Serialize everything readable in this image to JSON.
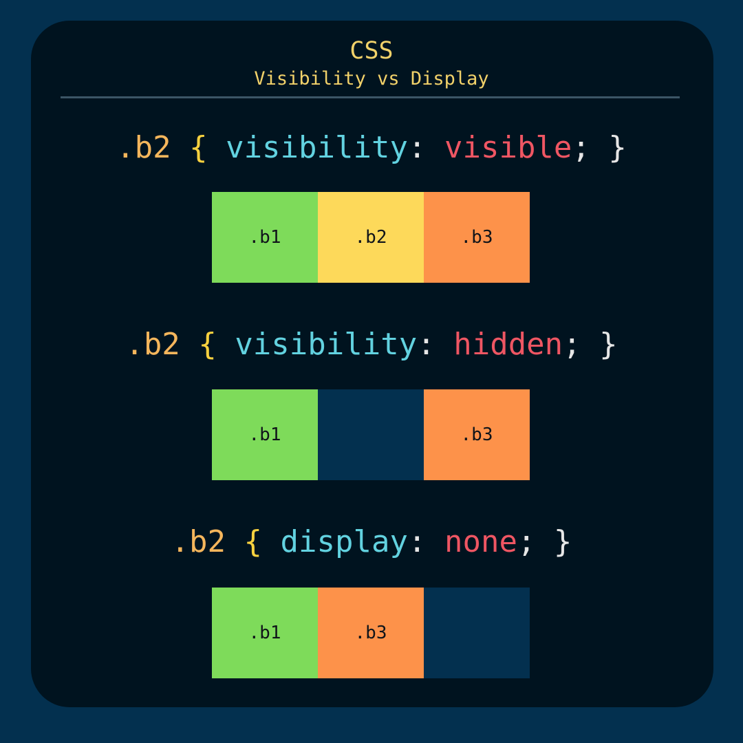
{
  "header": {
    "title": "CSS",
    "subtitle": "Visibility vs Display"
  },
  "examples": [
    {
      "selector": ".b2",
      "open_brace": "{",
      "property": "visibility",
      "colon": ":",
      "value": "visible",
      "semicolon_close": "; }",
      "boxes": [
        ".b1",
        ".b2",
        ".b3"
      ]
    },
    {
      "selector": ".b2",
      "open_brace": "{",
      "property": "visibility",
      "colon": ":",
      "value": "hidden",
      "semicolon_close": "; }",
      "boxes": [
        ".b1",
        "",
        ".b3"
      ]
    },
    {
      "selector": ".b2",
      "open_brace": "{",
      "property": "display",
      "colon": ":",
      "value": "none",
      "semicolon_close": "; }",
      "boxes": [
        ".b1",
        ".b3",
        ""
      ]
    }
  ],
  "colors": {
    "page_background": "#03304f",
    "card_background": "#00131f",
    "title": "#f2d26a",
    "selector": "#f5b65c",
    "brace": "#f7d13f",
    "property": "#62d2e0",
    "value": "#ef5663",
    "box_b1": "#7edb5a",
    "box_b2": "#fdd95a",
    "box_b3": "#fd924a",
    "box_empty": "#03304f"
  }
}
